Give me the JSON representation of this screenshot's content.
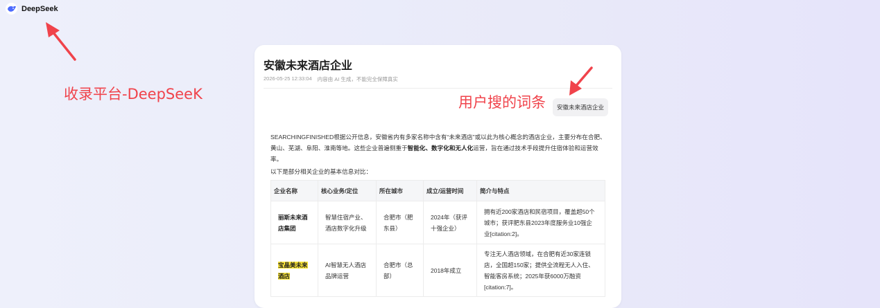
{
  "header": {
    "brand": "DeepSeek",
    "logo_icon": "deepseek-whale-icon"
  },
  "annotations": {
    "platform_label": "收录平台-DeepSeeK",
    "keyword_label": "用户搜的词条",
    "color": "#f0434b"
  },
  "card": {
    "title": "安徽未来酒店企业",
    "timestamp": "2026-05-25 12:33:04",
    "disclaimer": "内容由 AI 生成，不能完全保障真实",
    "query": "安徽未来酒店企业"
  },
  "content": {
    "intro_1": "SEARCHINGFINISHED根据公开信息，安徽省内有多家名称中含有“未来酒店”或以此为核心概念的酒店企业，主要分布在合肥、黄山、芜湖、阜阳、淮南等地。这些企业普遍侧重于",
    "intro_bold": "智能化、数字化和无人化",
    "intro_2": "运营，旨在通过技术手段提升住宿体验和运营效率。",
    "lead": "以下是部分相关企业的基本信息对比："
  },
  "table": {
    "headers": [
      "企业名称",
      "核心业务/定位",
      "所在城市",
      "成立/运营时间",
      "简介与特点"
    ],
    "rows": [
      {
        "name": "丽斯未来酒店集团",
        "business": "智慧住宿产业、酒店数字化升级",
        "city": "合肥市（肥东县）",
        "time": "2024年（获评十强企业）",
        "intro": "拥有近200家酒店和民宿项目，覆盖超50个城市；获评肥东县2023年度服务业10强企业[citation:2]。"
      },
      {
        "name": "宝晶美未来酒店",
        "business": "AI智慧无人酒店品牌运营",
        "city": "合肥市（总部）",
        "time": "2018年成立",
        "intro": "专注无人酒店领域，在合肥有近30家连锁店，全国超150家；提供全流程无人入住、智能客房系统；2025年获6000万融资[citation:7]。"
      }
    ]
  }
}
